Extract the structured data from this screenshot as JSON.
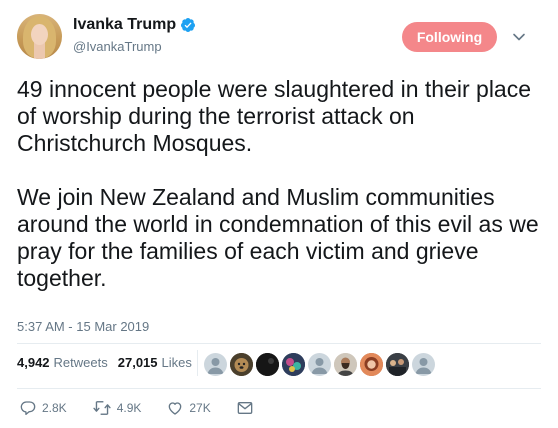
{
  "user": {
    "display_name": "Ivanka Trump",
    "handle": "@IvankaTrump",
    "verified": true
  },
  "follow_button": {
    "label": "Following",
    "color": "#f4878a"
  },
  "tweet": {
    "text": "49 innocent people were slaughtered in their place of worship during the terrorist attack on Christchurch Mosques.\n\nWe join New Zealand and Muslim communities around the world in condemnation of this evil as we pray for the families of each victim and grieve together.",
    "timestamp": "5:37 AM - 15 Mar 2019"
  },
  "stats": {
    "retweets_count": "4,942",
    "retweets_label": "Retweets",
    "likes_count": "27,015",
    "likes_label": "Likes"
  },
  "liker_avatars": [
    {
      "style": "default-silhouette"
    },
    {
      "style": "photo-dog"
    },
    {
      "style": "photo-dark"
    },
    {
      "style": "photo-colorful"
    },
    {
      "style": "default-silhouette"
    },
    {
      "style": "photo-man-beard"
    },
    {
      "style": "photo-woman"
    },
    {
      "style": "photo-group"
    },
    {
      "style": "default-silhouette"
    }
  ],
  "actions": {
    "replies": "2.8K",
    "retweets": "4.9K",
    "likes": "27K"
  },
  "colors": {
    "secondary_text": "#657786",
    "primary_text": "#14171a",
    "verified_blue": "#1da1f2",
    "divider": "#e6ecf0"
  }
}
